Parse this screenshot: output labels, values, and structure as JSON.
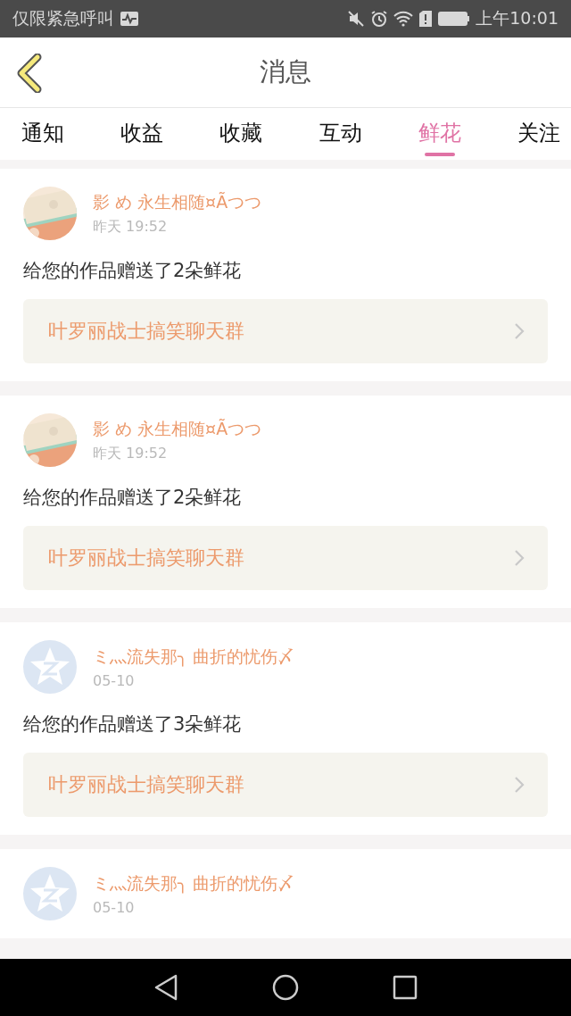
{
  "status_bar": {
    "notice": "仅限紧急呼叫",
    "time": "上午10:01"
  },
  "header": {
    "title": "消息"
  },
  "tabs": [
    {
      "label": "通知",
      "selected": false
    },
    {
      "label": "收益",
      "selected": false
    },
    {
      "label": "收藏",
      "selected": false
    },
    {
      "label": "互动",
      "selected": false
    },
    {
      "label": "鲜花",
      "selected": true
    },
    {
      "label": "关注",
      "selected": false
    }
  ],
  "messages": [
    {
      "name": "影 め 永生相随¤Ãつつ",
      "time": "昨天 19:52",
      "text": "给您的作品赠送了2朵鲜花",
      "link": "叶罗丽战士搞笑聊天群"
    },
    {
      "name": "影 め 永生相随¤Ãつつ",
      "time": "昨天 19:52",
      "text": "给您的作品赠送了2朵鲜花",
      "link": "叶罗丽战士搞笑聊天群"
    },
    {
      "avatar": {
        "kind": "default"
      },
      "name": "ミ灬流失那╮ 曲折的忧伤〆",
      "time": "05-10",
      "text": "给您的作品赠送了3朵鲜花",
      "link": "叶罗丽战士搞笑聊天群"
    },
    {
      "avatar": {
        "kind": "default"
      },
      "name": "ミ灬流失那╮ 曲折的忧伤〆",
      "time": "05-10"
    }
  ]
}
